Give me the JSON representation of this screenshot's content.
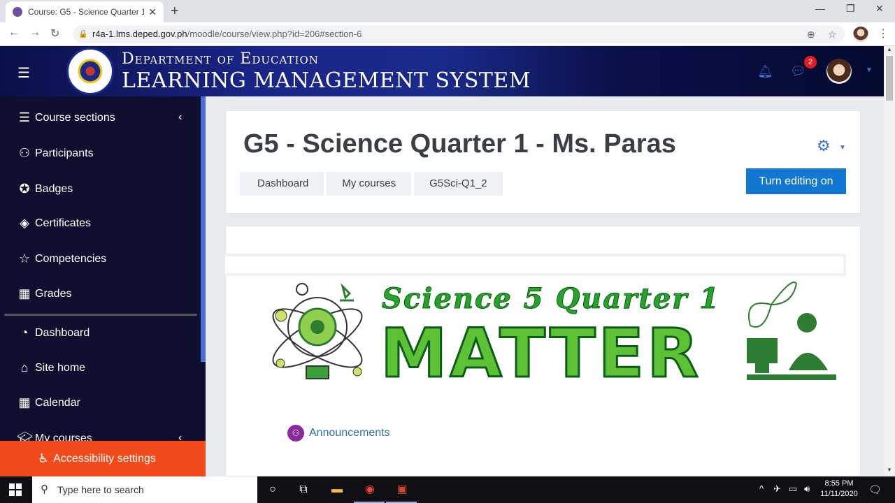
{
  "browser": {
    "tab_title": "Course: G5 - Science Quarter 1 -",
    "url_host": "r4a-1.lms.deped.gov.ph",
    "url_path": "/moodle/course/view.php?id=206#section-6"
  },
  "header": {
    "brand_top": "Department of Education",
    "brand_bottom": "LEARNING MANAGEMENT SYSTEM",
    "messages_badge": "2"
  },
  "sidebar": {
    "items": [
      {
        "label": "Course sections",
        "icon": "list-icon"
      },
      {
        "label": "Participants",
        "icon": "users-icon"
      },
      {
        "label": "Badges",
        "icon": "badge-icon"
      },
      {
        "label": "Certificates",
        "icon": "certificate-icon"
      },
      {
        "label": "Competencies",
        "icon": "star-icon"
      },
      {
        "label": "Grades",
        "icon": "table-icon"
      },
      {
        "label": "Dashboard",
        "icon": "dashboard-icon"
      },
      {
        "label": "Site home",
        "icon": "home-icon"
      },
      {
        "label": "Calendar",
        "icon": "calendar-icon"
      },
      {
        "label": "My courses",
        "icon": "graduation-cap-icon"
      }
    ],
    "accessibility": "Accessibility settings"
  },
  "course": {
    "title": "G5 - Science Quarter 1 - Ms. Paras",
    "breadcrumb": [
      "Dashboard",
      "My courses",
      "G5Sci-Q1_2"
    ],
    "edit_button": "Turn editing on"
  },
  "banner": {
    "headline": "Science 5 Quarter 1",
    "main_word": "MATTER"
  },
  "activity": {
    "announcements": "Announcements"
  },
  "taskbar": {
    "search_placeholder": "Type here to search",
    "time": "8:55 PM",
    "date": "11/11/2020"
  },
  "colors": {
    "sidebar_bg": "#0e0e2e",
    "accent_blue": "#1177d1",
    "accessibility_bar": "#f24a1a",
    "banner_green": "#5cc135"
  }
}
